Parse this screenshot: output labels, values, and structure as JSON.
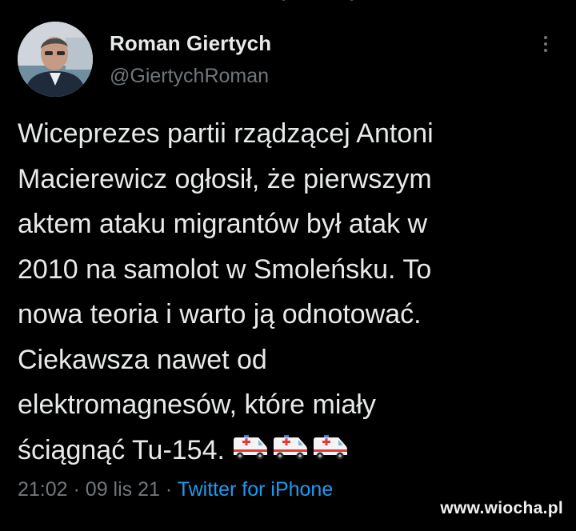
{
  "tweet": {
    "author": {
      "display_name": "Roman Giertych",
      "handle": "@GiertychRoman",
      "avatar_icon": "avatar-photo"
    },
    "text_lines": [
      "Wiceprezes partii rządzącej Antoni",
      "Macierewicz ogłosił, że pierwszym",
      "aktem ataku migrantów był atak w",
      "2010 na samolot w Smoleńsku. To",
      "nowa teoria i warto ją odnotować.",
      "Ciekawsza nawet od",
      "elektromagnesów, które miały",
      "ściągnąć Tu-154."
    ],
    "emoji": [
      "ambulance-icon",
      "ambulance-icon",
      "ambulance-icon"
    ],
    "time": "21:02",
    "separator_1": "·",
    "date": "09 lis 21",
    "separator_2": "·",
    "source": "Twitter for iPhone"
  },
  "watermark": "www.wiocha.pl",
  "colors": {
    "background": "#000000",
    "text": "#e7e9ea",
    "muted": "#71767b",
    "link": "#1d9bf0"
  }
}
